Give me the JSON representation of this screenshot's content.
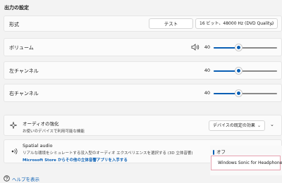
{
  "section_title": "出力の設定",
  "format": {
    "label": "形式",
    "test_button": "テスト",
    "value": "16 ビット、48000 Hz (DVD Quality)"
  },
  "volume": {
    "label": "ボリューム",
    "value": "40",
    "level_percent": 40
  },
  "left_channel": {
    "label": "左チャンネル",
    "value": "40",
    "level_percent": 40
  },
  "right_channel": {
    "label": "右チャンネル",
    "value": "40",
    "level_percent": 40
  },
  "enhance_audio": {
    "title": "オーディオの強化",
    "description": "お使いのデバイスで利用可能な機能",
    "select_value": "デバイスの既定の効果"
  },
  "spatial_audio": {
    "title": "Spatial audio",
    "description": "リアルな環境をシミュレートする没入型のオーディオ エクスペリエンスを選択する (3D 立体音響)",
    "link": "Microsoft Store からその他の立体音響アプリを入手する",
    "options": [
      "オフ",
      "Windows Sonic for Headphones"
    ],
    "selected": "オフ"
  },
  "help_link": "ヘルプを表示",
  "colors": {
    "accent": "#0a5fb4",
    "highlight_border": "#e7a2b0"
  }
}
